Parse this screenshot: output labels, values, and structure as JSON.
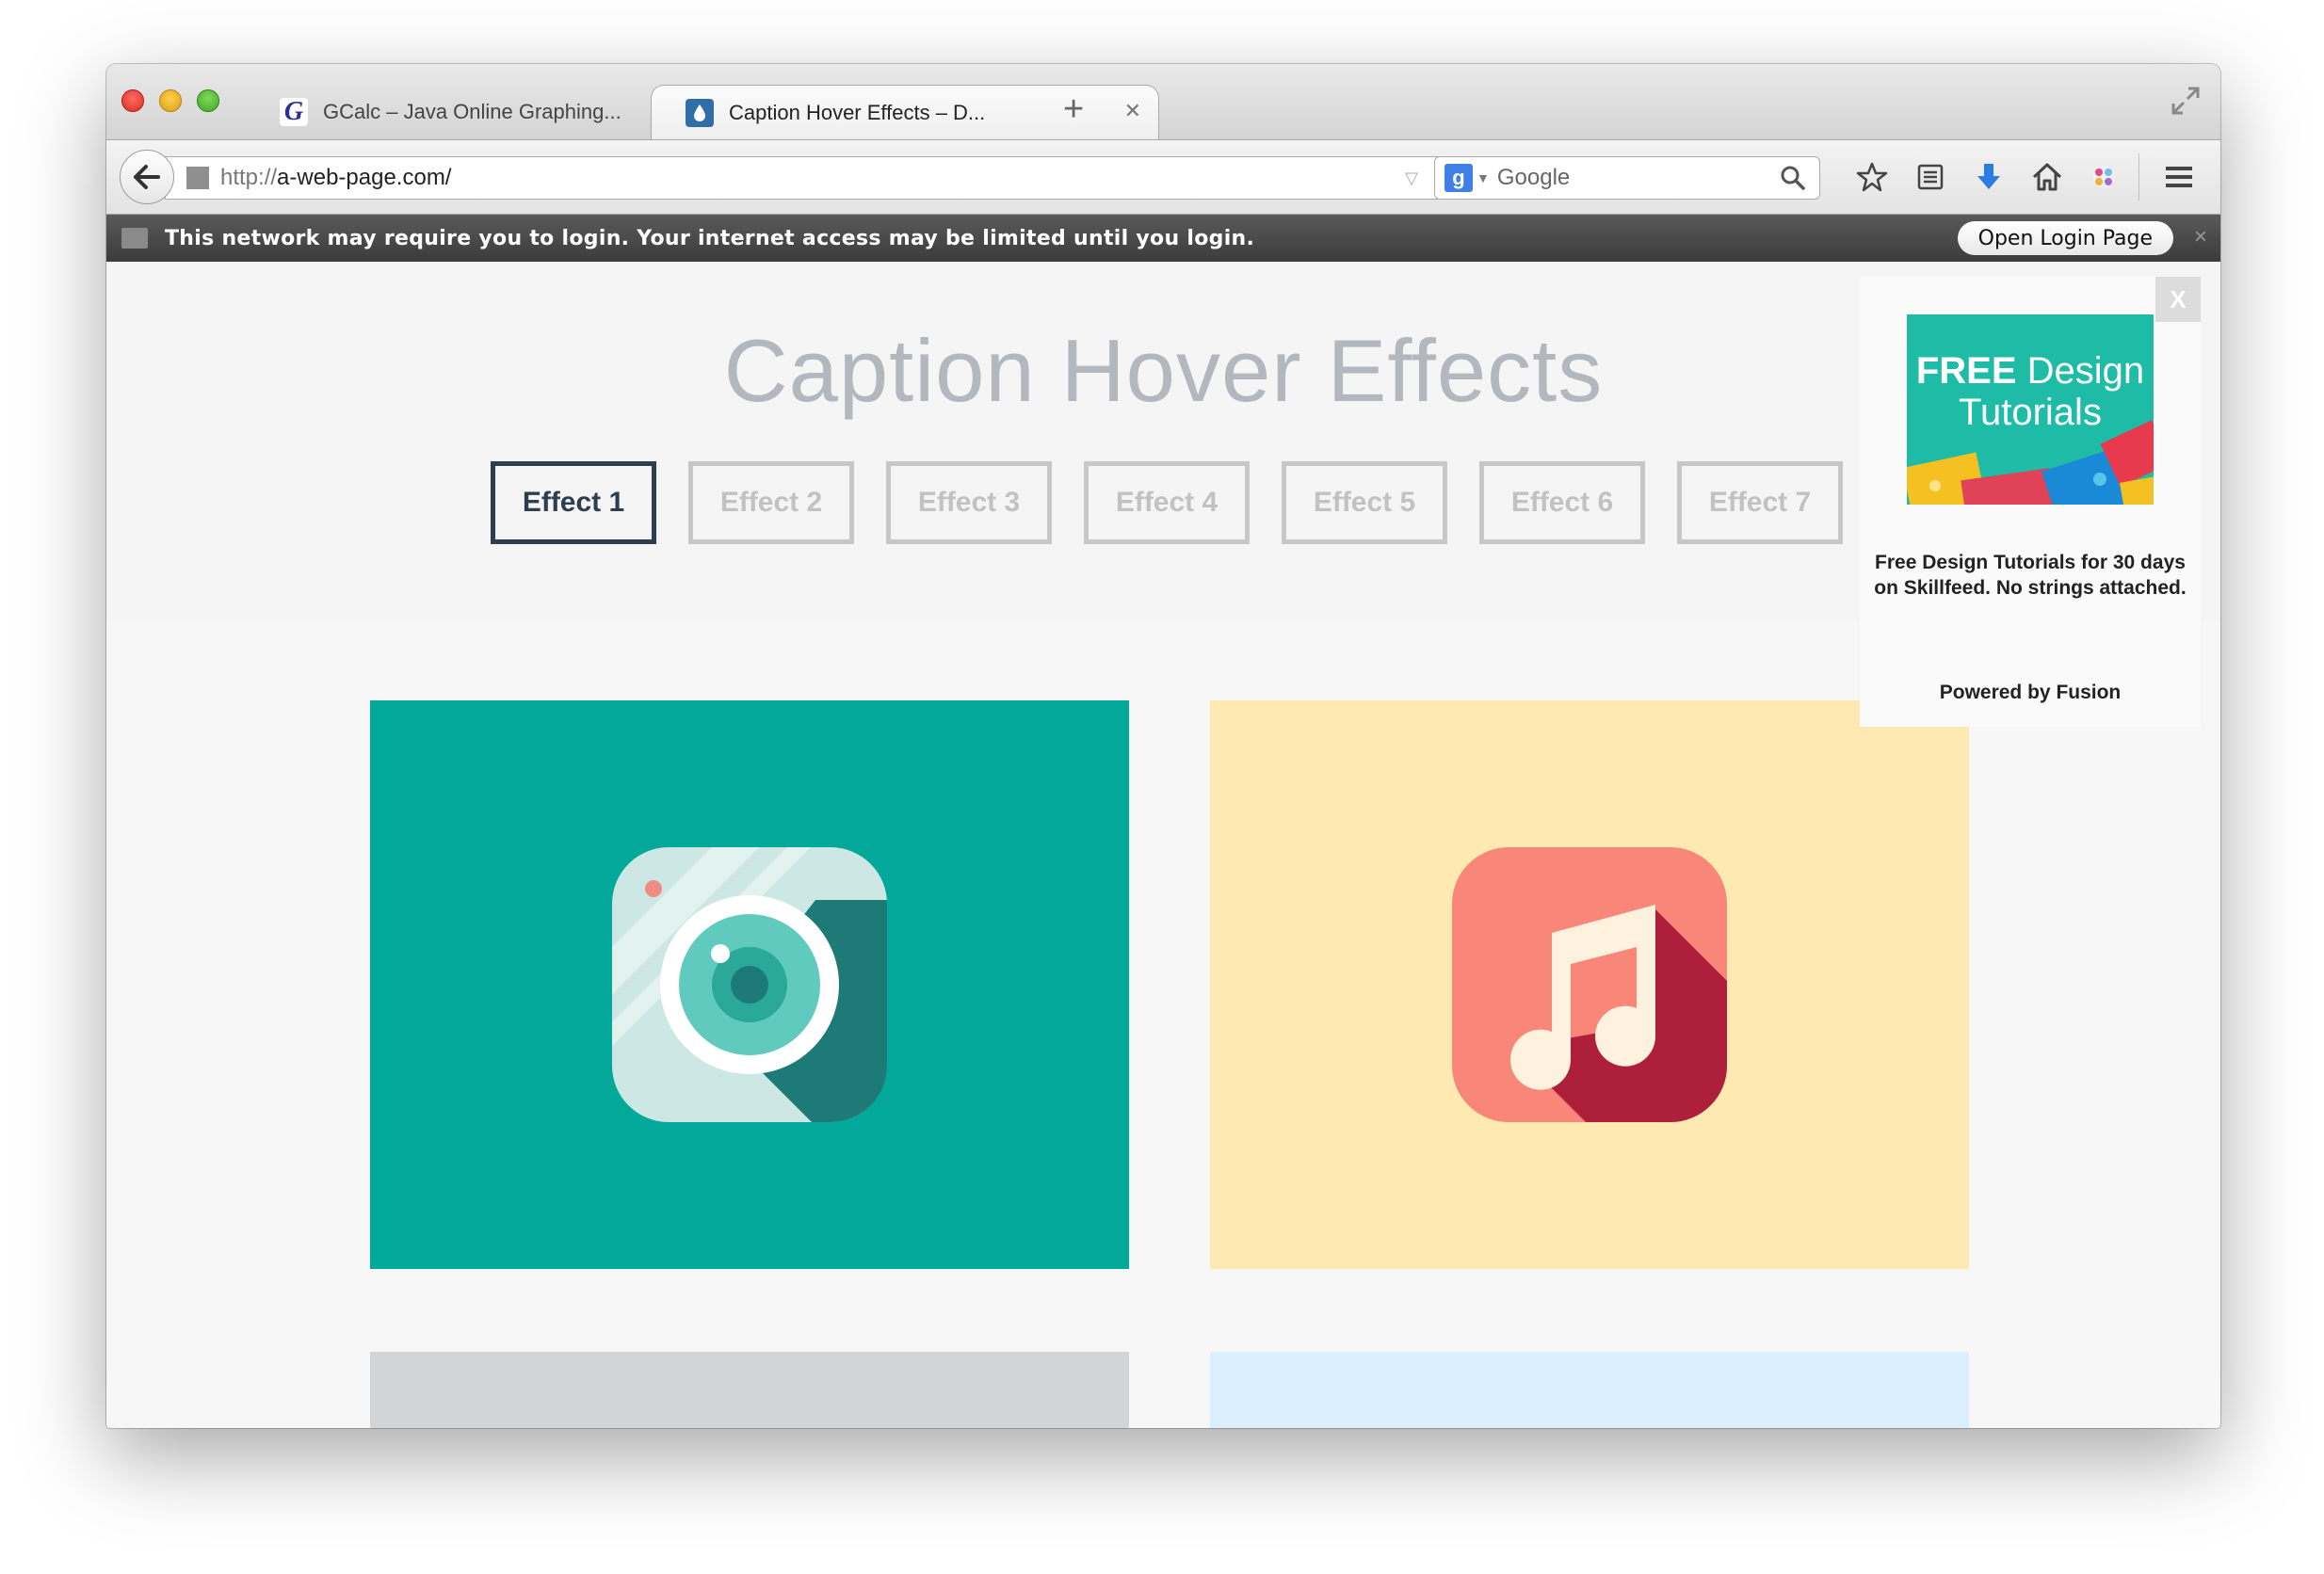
{
  "tabs": [
    {
      "title": "GCalc – Java Online Graphing...",
      "favicon": "G",
      "active": false
    },
    {
      "title": "Caption Hover Effects – D...",
      "favicon": "drop-icon",
      "active": true
    }
  ],
  "navbar": {
    "url_protocol": "http://",
    "url_rest": "a-web-page.com/",
    "search_placeholder": "Google",
    "search_engine_letter": "g"
  },
  "portal": {
    "message": "This network may require you to login. Your internet access may be limited until you login.",
    "button": "Open Login Page",
    "close": "×"
  },
  "page": {
    "title": "Caption Hover Effects",
    "effects": [
      "Effect 1",
      "Effect 2",
      "Effect 3",
      "Effect 4",
      "Effect 5",
      "Effect 6",
      "Effect 7"
    ],
    "active_effect": "Effect 1"
  },
  "ad": {
    "close": "X",
    "headline_bold": "FREE",
    "headline_rest": "Design",
    "headline_line2": "Tutorials",
    "text": "Free Design Tutorials for 30 days on Skillfeed. No strings attached.",
    "powered_by": "Powered by Fusion"
  },
  "colors": {
    "tile_teal": "#02a99a",
    "tile_yellow": "#fee9b2",
    "active_button": "#2d3e50",
    "ad_bg": "#1ebca6"
  },
  "icons": {
    "tile_1": "camera-icon",
    "tile_2": "music-note-icon"
  }
}
